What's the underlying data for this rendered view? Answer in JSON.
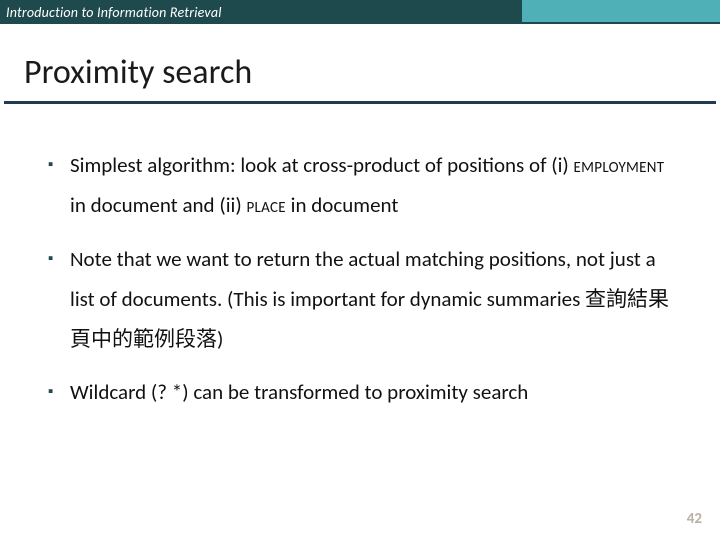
{
  "header": {
    "course": "Introduction to Information Retrieval"
  },
  "title": "Proximity search",
  "bullets": [
    {
      "pre": "Simplest algorithm: look at cross-product of positions of (i) ",
      "term1": "EMPLOYMENT",
      "mid": " in document and (ii) ",
      "term2": "PLACE",
      "post": " in document"
    },
    {
      "text": "Note that we want to return the actual matching positions, not just a list of documents. (This is important for dynamic summaries 查詢結果頁中的範例段落)"
    },
    {
      "text": "Wildcard (? *) can be transformed to proximity search"
    }
  ],
  "page_number": "42"
}
